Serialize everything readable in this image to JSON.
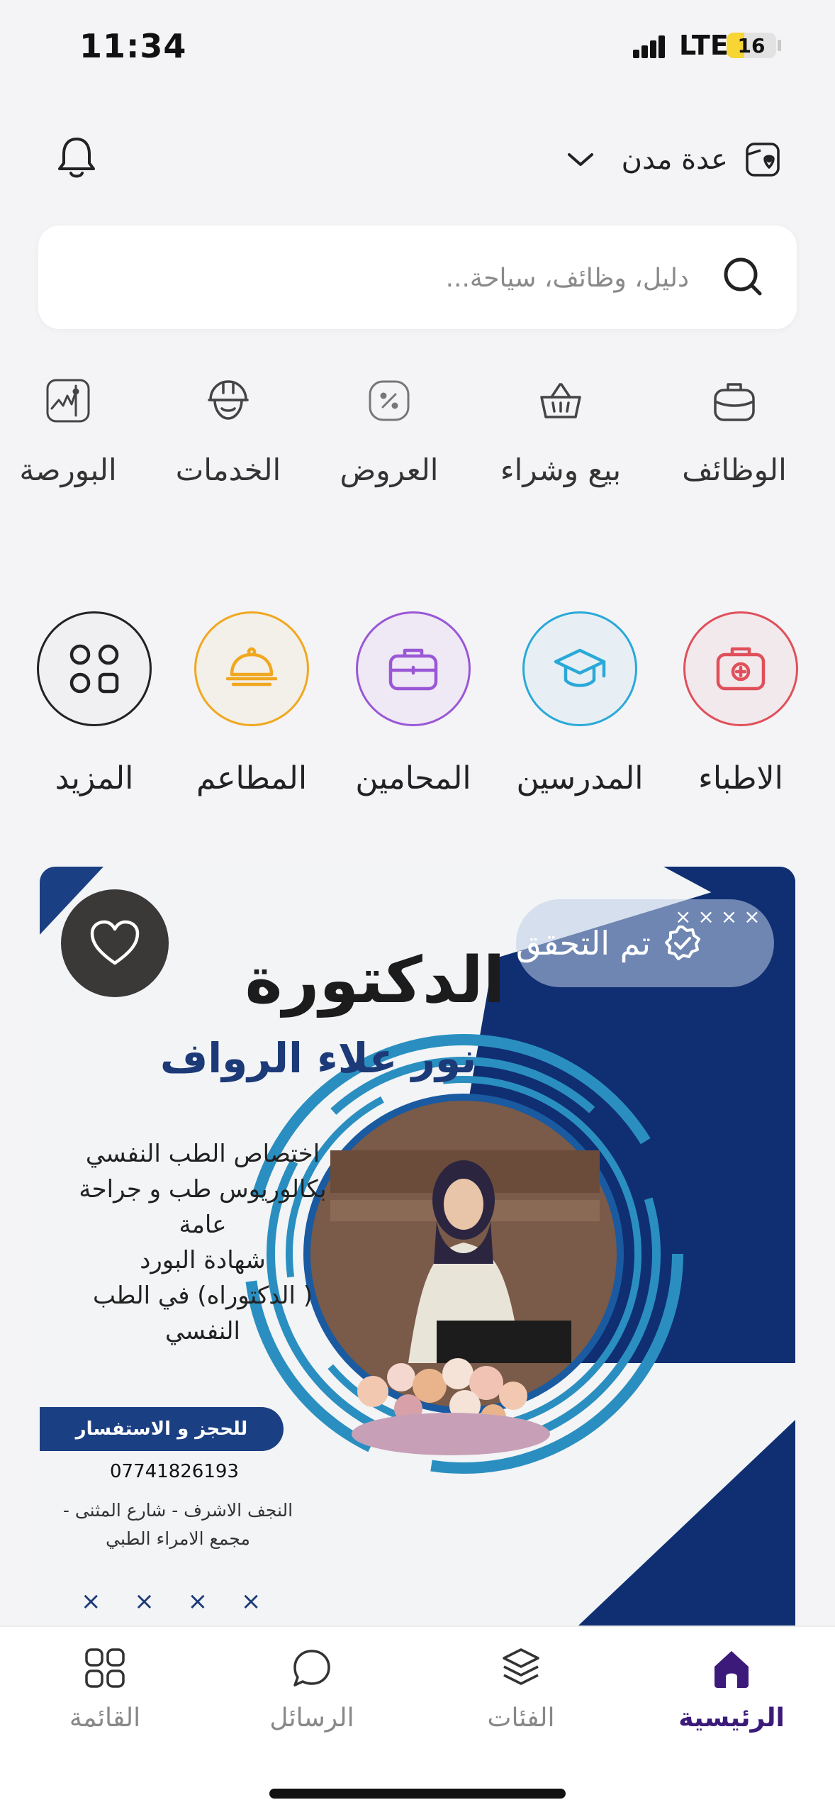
{
  "status_bar": {
    "time": "11:34",
    "network": "LTE",
    "battery": "16",
    "battery_level": 0.16
  },
  "header": {
    "city_label": "عدة مدن"
  },
  "search": {
    "placeholder": "دليل، وظائف، سياحة..."
  },
  "categories": [
    {
      "label": "الوظائف",
      "icon": "briefcase-icon"
    },
    {
      "label": "بيع وشراء",
      "icon": "basket-icon"
    },
    {
      "label": "العروض",
      "icon": "percent-tag-icon"
    },
    {
      "label": "الخدمات",
      "icon": "worker-helmet-icon"
    },
    {
      "label": "البورصة",
      "icon": "stock-chart-icon"
    }
  ],
  "professions": [
    {
      "label": "الاطباء",
      "icon": "first-aid-kit-icon",
      "color": "#e0505a"
    },
    {
      "label": "المدرسين",
      "icon": "graduation-cap-icon",
      "color": "#2aa9d8"
    },
    {
      "label": "المحامين",
      "icon": "briefcase-icon",
      "color": "#9a57d6"
    },
    {
      "label": "المطاعم",
      "icon": "food-cloche-icon",
      "color": "#f0a820"
    },
    {
      "label": "المزيد",
      "icon": "grid-more-icon",
      "color": "#222222"
    }
  ],
  "banner": {
    "verified_label": "تم التحقق",
    "title": "الدكتورة",
    "name": "نور علاء الرواف",
    "description": [
      "اختصاص الطب النفسي",
      "بكالوريوس طب و جراحة",
      "عامة",
      "شهادة البورد",
      "( الدكتوراه) في الطب",
      "النفسي"
    ],
    "booking_label": "للحجز و الاستفسار",
    "phone": "07741826193",
    "address": [
      "النجف الاشرف - شارع المثنى -",
      "مجمع الامراء الطبي"
    ],
    "decor_marks": "× × × ×",
    "close_marks": "× × × ×"
  },
  "bottom_nav": [
    {
      "label": "الرئيسية",
      "icon": "home-icon",
      "active": true
    },
    {
      "label": "الفئات",
      "icon": "layers-icon",
      "active": false
    },
    {
      "label": "الرسائل",
      "icon": "chat-bubble-icon",
      "active": false
    },
    {
      "label": "القائمة",
      "icon": "menu-grid-icon",
      "active": false
    }
  ],
  "colors": {
    "accent": "#3b1a7a",
    "banner_navy": "#1b3f83",
    "banner_ring": "#2a8fc0"
  }
}
